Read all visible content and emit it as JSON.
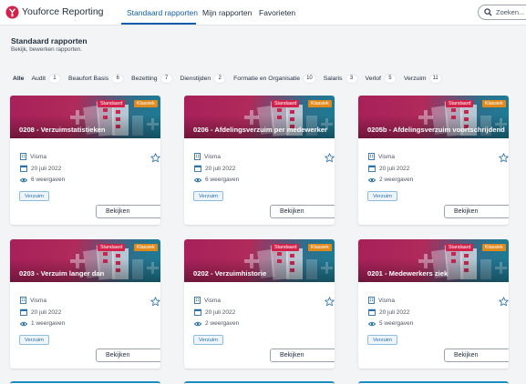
{
  "header": {
    "app_title": "Youforce Reporting",
    "tabs": [
      {
        "label": "Standaard rapporten",
        "active": true
      },
      {
        "label": "Mijn rapporten",
        "active": false
      },
      {
        "label": "Favorieten",
        "active": false
      }
    ],
    "search": {
      "placeholder": "Zoeken...",
      "icon": "search-icon"
    }
  },
  "page": {
    "title": "Standaard rapporten",
    "subtitle": "Bekijk, bewerken rapporten."
  },
  "filters": [
    {
      "label": "Alle",
      "count": null,
      "active": true
    },
    {
      "label": "Audit",
      "count": "1"
    },
    {
      "label": "Beaufort Basis",
      "count": "6"
    },
    {
      "label": "Bezetting",
      "count": "7"
    },
    {
      "label": "Dienstijden",
      "count": "2"
    },
    {
      "label": "Formatie en Organisatie",
      "count": "10"
    },
    {
      "label": "Salaris",
      "count": "3"
    },
    {
      "label": "Verlof",
      "count": "5"
    },
    {
      "label": "Verzuim",
      "count": "11"
    }
  ],
  "colors": {
    "accent": "#0e5ea8",
    "badge_standaard": "#d2224a",
    "badge_klassiek": "#e08a1e",
    "tag_border": "#8cbce0"
  },
  "cards": [
    {
      "title": "0208 - Verzuimstatistieken",
      "badge1": "Standaard",
      "badge2": "Klassiek",
      "publisher": "Visma",
      "date": "20 juli 2022",
      "views": "6 weergaven",
      "tag": "Verzuim",
      "button": "Bekijken"
    },
    {
      "title": "0206 - Afdelingsverzuim per medewerker",
      "badge1": "Standaard",
      "badge2": "Klassiek",
      "publisher": "Visma",
      "date": "20 juli 2022",
      "views": "6 weergaven",
      "tag": "Verzuim",
      "button": "Bekijken"
    },
    {
      "title": "0205b - Afdelingsverzuim voortschrijdend",
      "badge1": "Standaard",
      "badge2": "Klassiek",
      "publisher": "Visma",
      "date": "20 juli 2022",
      "views": "2 weergaven",
      "tag": "Verzuim",
      "button": "Bekijken"
    },
    {
      "title": "0203 - Verzuim langer dan",
      "badge1": "Standaard",
      "badge2": "Klassiek",
      "publisher": "Visma",
      "date": "20 juli 2022",
      "views": "1 weergaven",
      "tag": "Verzuim",
      "button": "Bekijken"
    },
    {
      "title": "0202 - Verzuimhistorie",
      "badge1": "Standaard",
      "badge2": "Klassiek",
      "publisher": "Visma",
      "date": "20 juli 2022",
      "views": "2 weergaven",
      "tag": "Verzuim",
      "button": "Bekijken"
    },
    {
      "title": "0201 - Medewerkers ziek",
      "badge1": "Standaard",
      "badge2": "Klassiek",
      "publisher": "Visma",
      "date": "20 juli 2022",
      "views": "5 weergaven",
      "tag": "Verzuim",
      "button": "Bekijken"
    }
  ]
}
